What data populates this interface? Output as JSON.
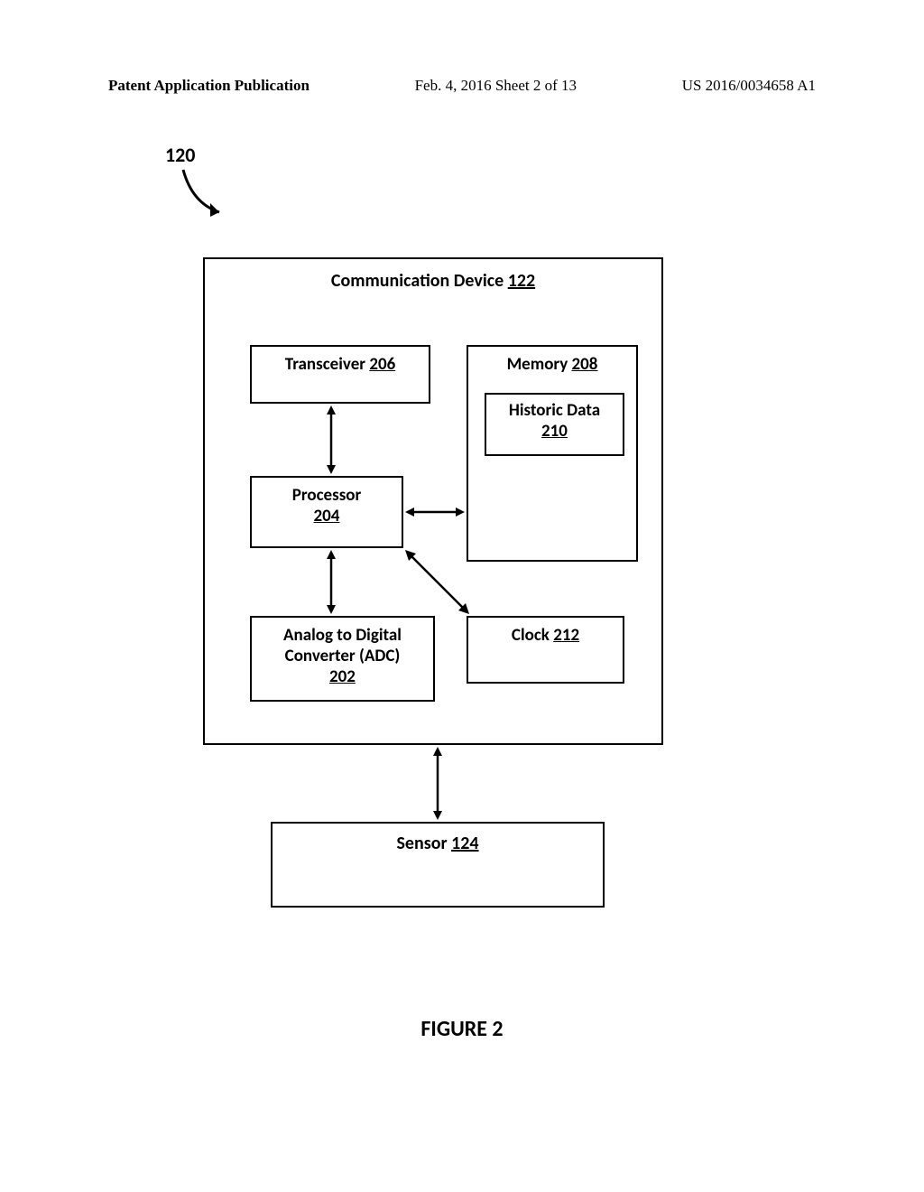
{
  "header": {
    "left": "Patent Application Publication",
    "center": "Feb. 4, 2016   Sheet 2 of 13",
    "right": "US 2016/0034658 A1"
  },
  "ref_number": "120",
  "main_box": {
    "title": "Communication Device ",
    "title_ref": "122"
  },
  "boxes": {
    "transceiver": {
      "label": "Transceiver ",
      "ref": "206"
    },
    "memory": {
      "label": "Memory ",
      "ref": "208"
    },
    "historic": {
      "label": "Historic Data",
      "ref": "210"
    },
    "processor": {
      "label": "Processor",
      "ref": "204"
    },
    "adc": {
      "label1": "Analog to Digital",
      "label2": "Converter (ADC)",
      "ref": "202"
    },
    "clock": {
      "label": "Clock ",
      "ref": "212"
    },
    "sensor": {
      "label": "Sensor ",
      "ref": "124"
    }
  },
  "figure_label": "FIGURE 2"
}
